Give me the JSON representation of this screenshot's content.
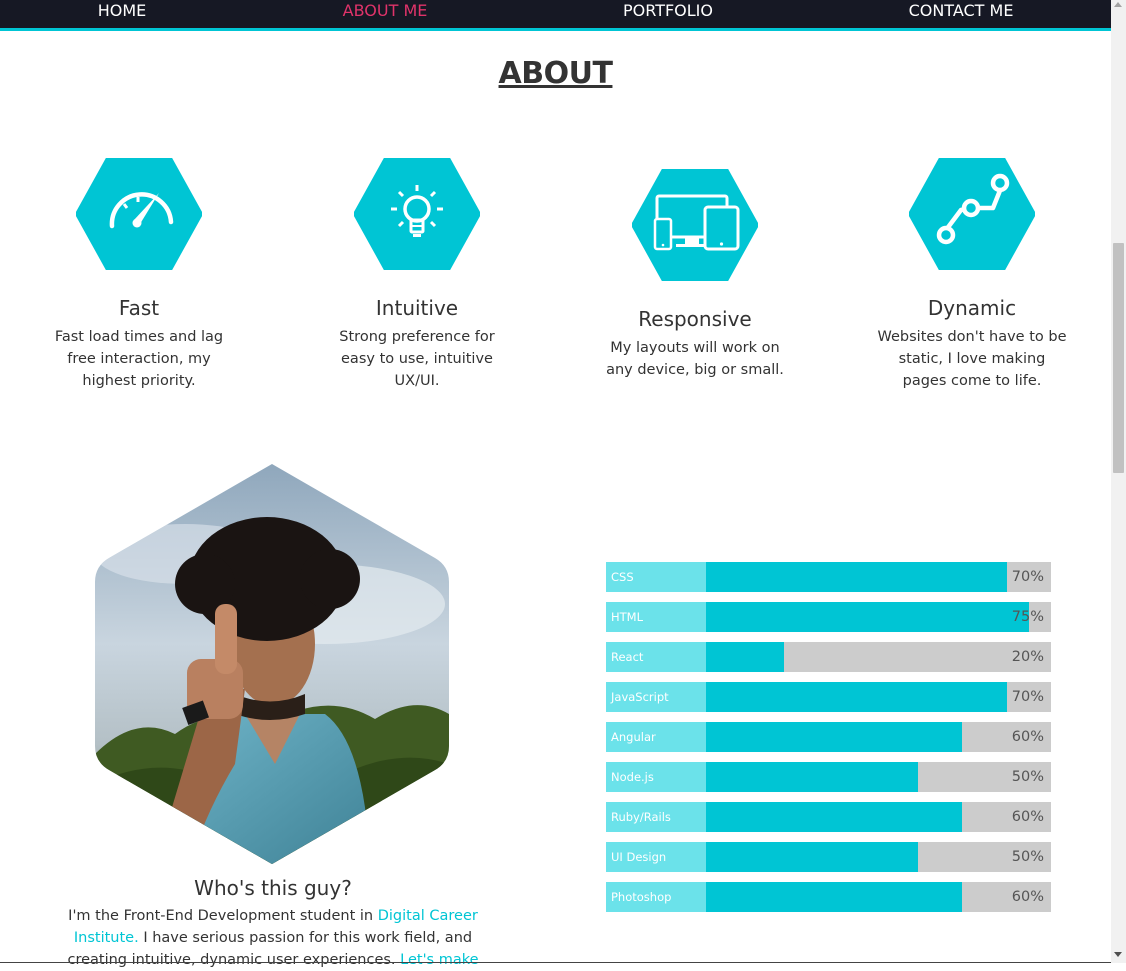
{
  "nav": {
    "items": [
      {
        "label": "HOME",
        "active": false
      },
      {
        "label": "ABOUT ME",
        "active": true
      },
      {
        "label": "PORTFOLIO",
        "active": false
      },
      {
        "label": "CONTACT ME",
        "active": false
      }
    ]
  },
  "about": {
    "title": "ABOUT",
    "features": [
      {
        "icon": "speedometer-icon",
        "title": "Fast",
        "desc": [
          "Fast load times and lag",
          "free interaction, my",
          "highest priority."
        ]
      },
      {
        "icon": "lightbulb-icon",
        "title": "Intuitive",
        "desc": [
          "Strong preference for",
          "easy to use, intuitive",
          "UX/UI."
        ]
      },
      {
        "icon": "devices-icon",
        "title": "Responsive",
        "desc": [
          "My layouts will work on",
          "any device, big or small."
        ]
      },
      {
        "icon": "circuit-path-icon",
        "title": "Dynamic",
        "desc": [
          "Websites don't have to be",
          "static, I love making",
          "pages come to life."
        ]
      }
    ]
  },
  "who": {
    "title": "Who's this guy?",
    "text_1": "I'm the Front-End Development student in ",
    "link_1": "Digital Career Institute.",
    "text_2": " I have serious passion for this work field, and creating intuitive, dynamic user experiences. ",
    "link_2": "Let's make"
  },
  "skills": [
    {
      "name": "CSS",
      "percent": 70,
      "label": "70%"
    },
    {
      "name": "HTML",
      "percent": 75,
      "label": "75%"
    },
    {
      "name": "React",
      "percent": 20,
      "label": "20%"
    },
    {
      "name": "JavaScript",
      "percent": 70,
      "label": "70%"
    },
    {
      "name": "Angular",
      "percent": 60,
      "label": "60%"
    },
    {
      "name": "Node.js",
      "percent": 50,
      "label": "50%"
    },
    {
      "name": "Ruby/Rails",
      "percent": 60,
      "label": "60%"
    },
    {
      "name": "UI Design",
      "percent": 50,
      "label": "50%"
    },
    {
      "name": "Photoshop",
      "percent": 60,
      "label": "60%"
    }
  ],
  "colors": {
    "accent": "#00c5d4",
    "accent_light": "#6be2ea",
    "nav_bg": "#161824",
    "nav_active": "#e0336a",
    "bar_track": "#cccccc"
  }
}
